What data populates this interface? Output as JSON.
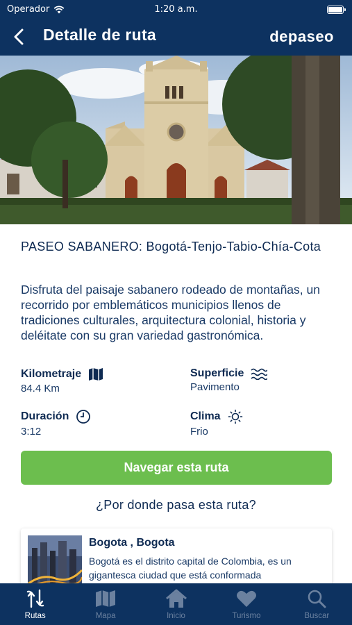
{
  "status_bar": {
    "carrier": "Operador",
    "time": "1:20 a.m."
  },
  "nav": {
    "title": "Detalle de ruta",
    "brand": "depaseo"
  },
  "route": {
    "title": "PASEO SABANERO: Bogotá-Tenjo-Tabio-Chía-Cota",
    "description": "Disfruta del paisaje sabanero rodeado de montañas, un recorrido por emblemáticos municipios llenos de tradiciones culturales, arquitectura colonial, historia y deléitate con su gran variedad gastronómica."
  },
  "stats": {
    "kilometraje": {
      "label": "Kilometraje",
      "value": "84.4 Km"
    },
    "superficie": {
      "label": "Superficie",
      "value": "Pavimento"
    },
    "duracion": {
      "label": "Duración",
      "value": "3:12"
    },
    "clima": {
      "label": "Clima",
      "value": "Frio"
    }
  },
  "navigate_button": "Navegar esta ruta",
  "section_question": "¿Por donde pasa esta ruta?",
  "stops": [
    {
      "title": "Bogota , Bogota",
      "description": "Bogotá es el distrito capital de Colombia, es un gigantesca ciudad que está conformada"
    }
  ],
  "tabs": [
    {
      "label": "Rutas",
      "icon": "routes-icon",
      "active": true
    },
    {
      "label": "Mapa",
      "icon": "map-icon",
      "active": false
    },
    {
      "label": "Inicio",
      "icon": "home-icon",
      "active": false
    },
    {
      "label": "Turismo",
      "icon": "heart-icon",
      "active": false
    },
    {
      "label": "Buscar",
      "icon": "search-icon",
      "active": false
    }
  ],
  "colors": {
    "header": "#0d3260",
    "accent_green": "#6cbe4e",
    "text_dark": "#0e2a52"
  }
}
